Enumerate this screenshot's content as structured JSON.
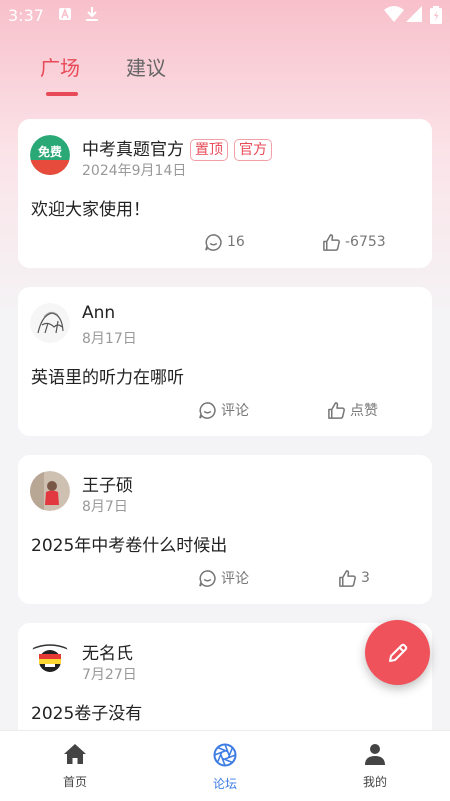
{
  "status_bar": {
    "time": "3:37"
  },
  "tabs": [
    {
      "label": "广场",
      "active": true
    },
    {
      "label": "建议",
      "active": false
    }
  ],
  "posts": [
    {
      "author": "中考真题官方",
      "badges": [
        "置顶",
        "官方"
      ],
      "date": "2024年9月14日",
      "content": "欢迎大家使用！",
      "comment_label": "16",
      "like_label": "-6753",
      "avatar": "app-logo-avatar"
    },
    {
      "author": "Ann",
      "date": "8月17日",
      "content": "英语里的听力在哪听",
      "comment_label": "评论",
      "like_label": "点赞",
      "avatar": "sketch-avatar"
    },
    {
      "author": "王子硕",
      "date": "8月7日",
      "content": "2025年中考卷什么时候出",
      "comment_label": "评论",
      "like_label": "3",
      "avatar": "photo-avatar"
    },
    {
      "author": "无名氏",
      "date": "7月27日",
      "content": "2025卷子没有",
      "avatar": "cartoon-avatar"
    }
  ],
  "fab": {
    "icon": "pencil-icon"
  },
  "bottom_nav": [
    {
      "label": "首页",
      "icon": "home-icon",
      "active": false
    },
    {
      "label": "论坛",
      "icon": "aperture-icon",
      "active": true
    },
    {
      "label": "我的",
      "icon": "person-icon",
      "active": false
    }
  ],
  "colors": {
    "accent": "#e84a57",
    "nav_active": "#3d7de4",
    "fab": "#f0525c"
  }
}
